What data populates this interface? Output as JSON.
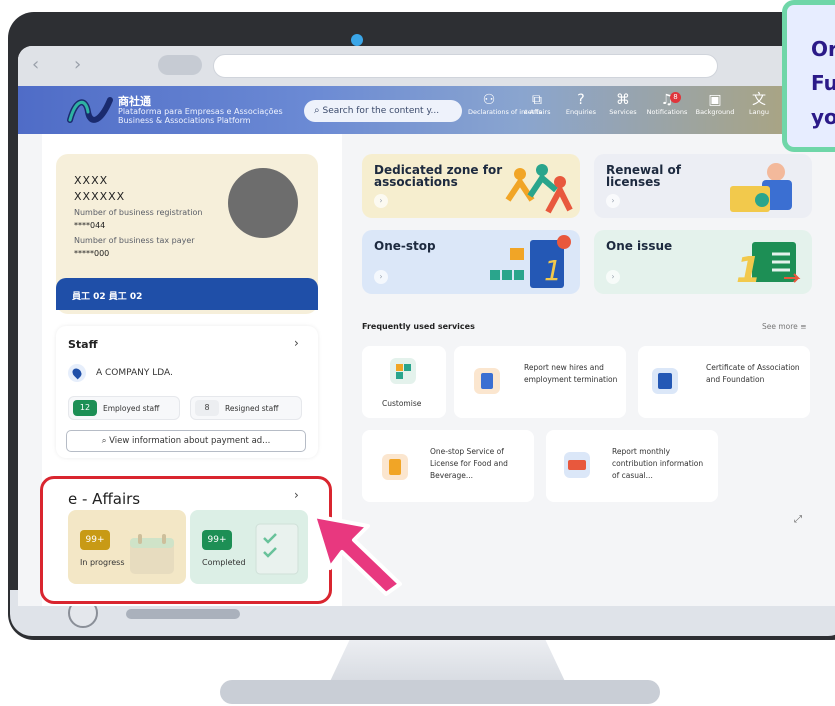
{
  "header": {
    "logo_cn": "商社通",
    "logo_line1": "Plataforma para Empresas e Associações",
    "logo_line2": "Business & Associations Platform",
    "search_placeholder": "Search for the content y...",
    "nav": [
      {
        "icon": "declarations-icon",
        "label": "Declarations of intents"
      },
      {
        "icon": "e-affairs-icon",
        "label": "e-Affairs"
      },
      {
        "icon": "enquiries-icon",
        "label": "Enquiries"
      },
      {
        "icon": "services-icon",
        "label": "Services"
      },
      {
        "icon": "bell-icon",
        "label": "Notifications",
        "badge": "8"
      },
      {
        "icon": "background-icon",
        "label": "Background"
      },
      {
        "icon": "language-icon",
        "label": "Langu"
      }
    ]
  },
  "profile": {
    "name1": "XXXX",
    "name2": "XXXXXX",
    "reg_label": "Number of business registration",
    "reg_value": "****044",
    "tax_label": "Number of business tax payer",
    "tax_value": "*****000",
    "staff_band": "員工 02 員工 02"
  },
  "staff": {
    "title": "Staff",
    "company": "A COMPANY LDA.",
    "employed_count": "12",
    "employed_label": "Employed staff",
    "resigned_count": "8",
    "resigned_label": "Resigned staff",
    "view_button": "View information about payment ad..."
  },
  "eaffairs": {
    "title": "e - Affairs",
    "in_progress_count": "99+",
    "in_progress_label": "In progress",
    "completed_count": "99+",
    "completed_label": "Completed"
  },
  "zones": [
    {
      "title": "Dedicated zone for associations"
    },
    {
      "title": "Renewal of licenses"
    },
    {
      "title": "One-stop"
    },
    {
      "title": "One issue"
    }
  ],
  "services": {
    "title": "Frequently used services",
    "see_more": "See more",
    "items": [
      {
        "label": "Customise"
      },
      {
        "label": "Report new hires and employment termination"
      },
      {
        "label": "Certificate of Association and Foundation"
      },
      {
        "label": "One-stop Service of License for Food and Beverage..."
      },
      {
        "label": "Report monthly contribution information of casual..."
      }
    ]
  },
  "tooltip": {
    "line1": "Or",
    "line2": "Fu",
    "line3": "yo"
  },
  "colors": {
    "highlight_frame": "#d9252f",
    "arrow": "#e8387f",
    "brand_blue": "#1f4fa8",
    "eaffairs_badge": "#c89a15",
    "completed_badge": "#1d8f55"
  }
}
